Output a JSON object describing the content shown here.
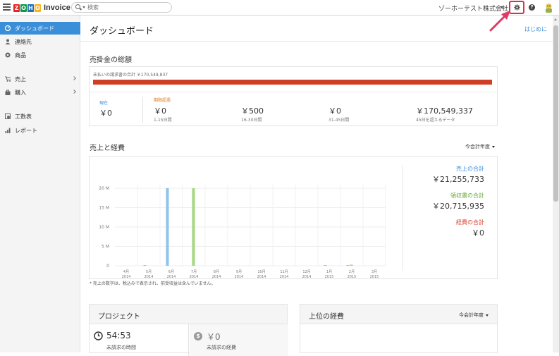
{
  "topbar": {
    "logo_letters": [
      "Z",
      "O",
      "H",
      "O"
    ],
    "logo_colors": [
      "#e42527",
      "#089949",
      "#226db4",
      "#f9b21d"
    ],
    "product_name": "Invoice",
    "search_placeholder": "検索",
    "org_name": "ゾーホーテスト株式会社"
  },
  "sidebar": {
    "items": [
      {
        "label": "ダッシュボード",
        "icon": "dashboard-icon"
      },
      {
        "label": "連絡先",
        "icon": "person-icon"
      },
      {
        "label": "商品",
        "icon": "item-icon"
      },
      {
        "label": "売上",
        "icon": "cart-icon"
      },
      {
        "label": "購入",
        "icon": "bag-icon"
      },
      {
        "label": "工数表",
        "icon": "timesheet-icon"
      },
      {
        "label": "レポート",
        "icon": "report-icon"
      }
    ]
  },
  "header": {
    "title": "ダッシュボード",
    "start_link": "はじめに"
  },
  "receivables": {
    "title": "売掛金の総額",
    "total_label": "未払いの請求書の合計 ￥170,549,837",
    "bar_color": "#cf3f26",
    "current_label": "現在",
    "current_value": "￥0",
    "overdue_label": "期限超過",
    "buckets": [
      {
        "value": "￥0",
        "label": "1-15日間"
      },
      {
        "value": "￥500",
        "label": "16-30日間"
      },
      {
        "value": "￥0",
        "label": "31-45日間"
      },
      {
        "value": "￥170,549,337",
        "label": "45日を超えるデータ"
      }
    ]
  },
  "sales_expenses": {
    "title": "売上と経費",
    "period": "今会計年度",
    "totals": [
      {
        "label": "売上の合計",
        "value": "￥21,255,733",
        "color": "#3b8ed8"
      },
      {
        "label": "領収書の合計",
        "value": "￥20,715,935",
        "color": "#6aab3a"
      },
      {
        "label": "経費の合計",
        "value": "￥0",
        "color": "#d9412f"
      }
    ],
    "note": "* 売上の数字は、税込みで表示され、前受収益は含んでいません。"
  },
  "chart_data": {
    "type": "bar",
    "categories": [
      "4月\n2014",
      "5月\n2014",
      "6月\n2014",
      "7月\n2014",
      "8月\n2014",
      "9月\n2014",
      "10月\n2014",
      "11月\n2014",
      "12月\n2014",
      "1月\n2015",
      "2月\n2015",
      "3月\n2015"
    ],
    "yticks": [
      "0",
      "5 M",
      "10 M",
      "15 M",
      "20 M"
    ],
    "ylim": [
      0,
      20000000
    ],
    "series": [
      {
        "color": "#8ec3ea",
        "values": [
          0,
          30000,
          20000000,
          0,
          0,
          0,
          0,
          0,
          0,
          30000,
          70000,
          0
        ]
      },
      {
        "color": "#a6d87f",
        "values": [
          0,
          0,
          0,
          20000000,
          0,
          0,
          0,
          0,
          0,
          0,
          300000,
          0
        ]
      },
      {
        "color": "#e58a7c",
        "values": [
          0,
          0,
          0,
          0,
          0,
          0,
          0,
          0,
          0,
          0,
          0,
          0
        ]
      }
    ],
    "xlabel": "",
    "ylabel": "",
    "grid": true
  },
  "projects": {
    "title": "プロジェクト",
    "hours_value": "54:53",
    "hours_label": "未請求の時間",
    "expense_value": "￥0",
    "expense_label": "未請求の経費"
  },
  "top_expenses": {
    "title": "上位の経費",
    "period": "今会計年度"
  }
}
